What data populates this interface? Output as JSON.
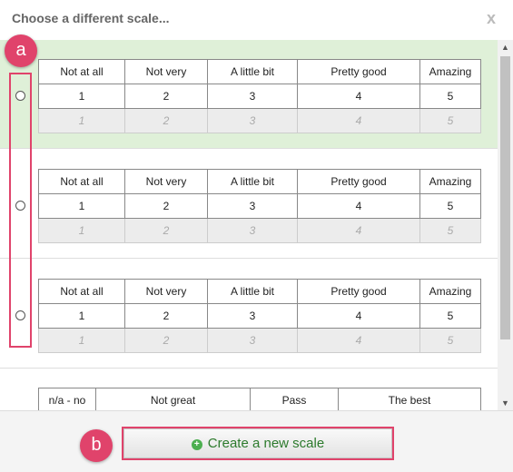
{
  "dialog": {
    "title": "Choose a different scale...",
    "close_label": "x"
  },
  "scales": [
    {
      "headers": [
        "Not at all",
        "Not very",
        "A little bit",
        "Pretty good",
        "Amazing"
      ],
      "values": [
        "1",
        "2",
        "3",
        "4",
        "5"
      ],
      "muted_values": [
        "1",
        "2",
        "3",
        "4",
        "5"
      ],
      "selected": true
    },
    {
      "headers": [
        "Not at all",
        "Not very",
        "A little bit",
        "Pretty good",
        "Amazing"
      ],
      "values": [
        "1",
        "2",
        "3",
        "4",
        "5"
      ],
      "muted_values": [
        "1",
        "2",
        "3",
        "4",
        "5"
      ],
      "selected": false
    },
    {
      "headers": [
        "Not at all",
        "Not very",
        "A little bit",
        "Pretty good",
        "Amazing"
      ],
      "values": [
        "1",
        "2",
        "3",
        "4",
        "5"
      ],
      "muted_values": [
        "1",
        "2",
        "3",
        "4",
        "5"
      ],
      "selected": false
    },
    {
      "headers": [
        "n/a - no",
        "Not great",
        "Pass",
        "The best"
      ]
    }
  ],
  "scrollbar": {
    "up": "▲",
    "down": "▼"
  },
  "footer": {
    "create_label": "Create a new scale",
    "create_icon": "plus-circle-icon"
  },
  "annotations": {
    "a": "a",
    "b": "b"
  },
  "colors": {
    "selected_bg": "#dff0d8",
    "highlight": "#e0436b",
    "button_text": "#2c7a2c"
  }
}
